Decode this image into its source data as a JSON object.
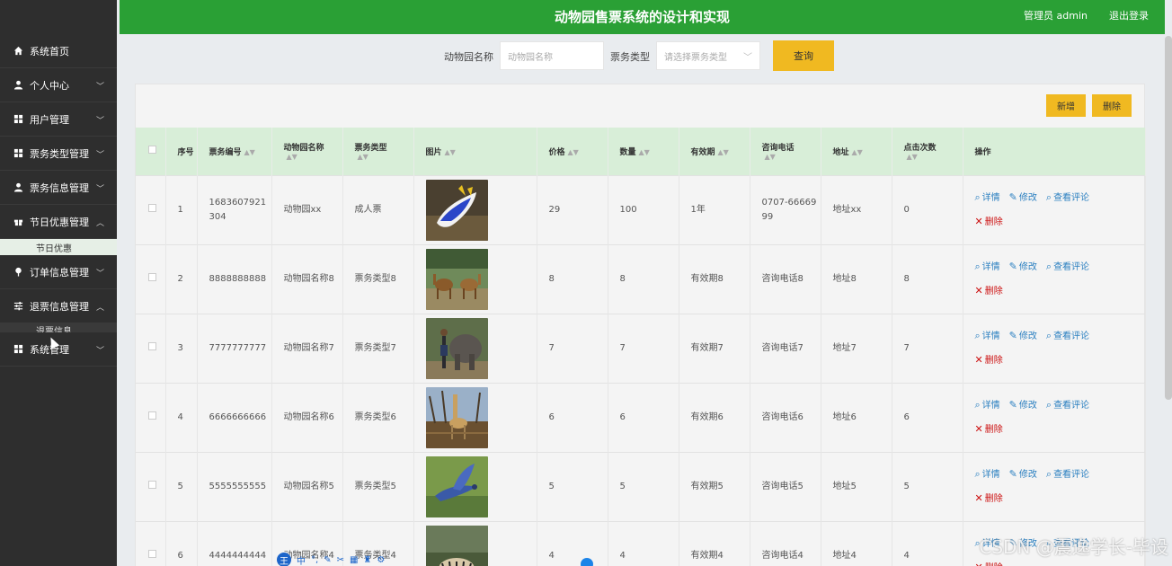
{
  "header": {
    "title": "动物园售票系统的设计和实现",
    "user": "管理员 admin",
    "logout": "退出登录"
  },
  "sidebar": {
    "items": [
      {
        "label": "系统首页",
        "icon": "home-icon"
      },
      {
        "label": "个人中心",
        "icon": "user-icon",
        "chevron": "﹀"
      },
      {
        "label": "用户管理",
        "icon": "grid-icon",
        "chevron": "﹀"
      },
      {
        "label": "票务类型管理",
        "icon": "grid-icon",
        "chevron": "﹀"
      },
      {
        "label": "票务信息管理",
        "icon": "user-icon",
        "chevron": "﹀"
      },
      {
        "label": "节日优惠管理",
        "icon": "gift-icon",
        "chevron": "︿"
      },
      {
        "label": "订单信息管理",
        "icon": "pin-icon",
        "chevron": "﹀"
      },
      {
        "label": "退票信息管理",
        "icon": "sliders-icon",
        "chevron": "︿"
      },
      {
        "label": "系统管理",
        "icon": "grid-icon",
        "chevron": "﹀"
      }
    ],
    "sub_holiday": "节日优惠",
    "sub_refund": "退票信息"
  },
  "search": {
    "zoo_label": "动物园名称",
    "zoo_placeholder": "动物园名称",
    "type_label": "票务类型",
    "type_placeholder": "请选择票务类型",
    "query": "查询"
  },
  "actions": {
    "add": "新增",
    "delete": "删除"
  },
  "table": {
    "headers": [
      "序号",
      "票务编号",
      "动物园名称",
      "票务类型",
      "图片",
      "价格",
      "数量",
      "有效期",
      "咨询电话",
      "地址",
      "点击次数",
      "操作"
    ],
    "rows": [
      {
        "no": "1",
        "code": "1683607921304",
        "zoo": "动物园xx",
        "type": "成人票",
        "price": "29",
        "qty": "100",
        "valid": "1年",
        "phone": "0707-6666999",
        "addr": "地址xx",
        "clicks": "0",
        "img": "sea-slug"
      },
      {
        "no": "2",
        "code": "8888888888",
        "zoo": "动物园名称8",
        "type": "票务类型8",
        "price": "8",
        "qty": "8",
        "valid": "有效期8",
        "phone": "咨询电话8",
        "addr": "地址8",
        "clicks": "8",
        "img": "camels"
      },
      {
        "no": "3",
        "code": "7777777777",
        "zoo": "动物园名称7",
        "type": "票务类型7",
        "price": "7",
        "qty": "7",
        "valid": "有效期7",
        "phone": "咨询电话7",
        "addr": "地址7",
        "clicks": "7",
        "img": "elephant"
      },
      {
        "no": "4",
        "code": "6666666666",
        "zoo": "动物园名称6",
        "type": "票务类型6",
        "price": "6",
        "qty": "6",
        "valid": "有效期6",
        "phone": "咨询电话6",
        "addr": "地址6",
        "clicks": "6",
        "img": "giraffe"
      },
      {
        "no": "5",
        "code": "5555555555",
        "zoo": "动物园名称5",
        "type": "票务类型5",
        "price": "5",
        "qty": "5",
        "valid": "有效期5",
        "phone": "咨询电话5",
        "addr": "地址5",
        "clicks": "5",
        "img": "bird"
      },
      {
        "no": "6",
        "code": "4444444444",
        "zoo": "动物园名称4",
        "type": "票务类型4",
        "price": "4",
        "qty": "4",
        "valid": "有效期4",
        "phone": "咨询电话4",
        "addr": "地址4",
        "clicks": "4",
        "img": "tiger"
      }
    ],
    "op_detail": "详情",
    "op_edit": "修改",
    "op_comments": "查看评论",
    "op_delete": "删除"
  },
  "watermark": "CSDN @震逸学长-毕设",
  "ime": {
    "badge": "王",
    "zh": "中"
  },
  "colors": {
    "header": "#2aa035",
    "sidebar": "#2e2e2e",
    "button": "#f0b921",
    "thead": "#d8eed8",
    "link": "#2a7fc0",
    "danger": "#cc1111"
  }
}
